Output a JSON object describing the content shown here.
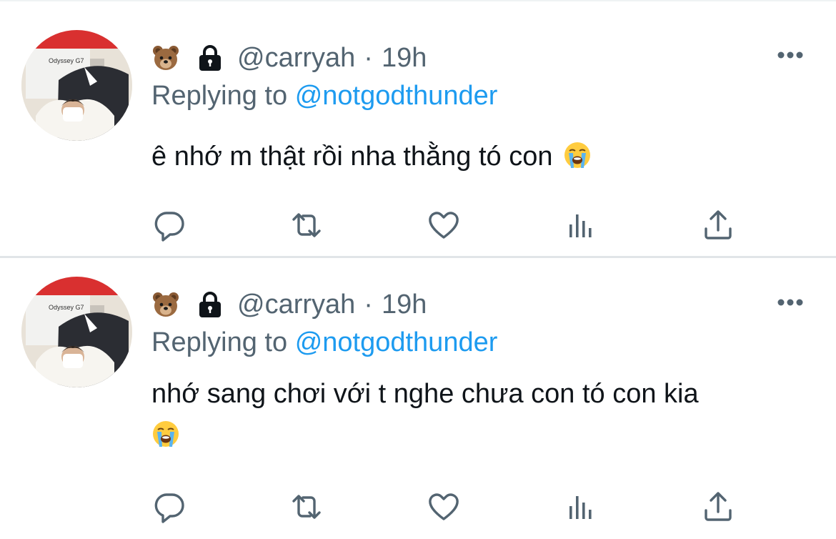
{
  "tweets": [
    {
      "handle": "@carryah",
      "separator": "·",
      "time": "19h",
      "reply_prefix": "Replying to",
      "reply_to": "@notgodthunder",
      "text": "ê nhớ m thật rồi nha thằng tó con",
      "emojis": [
        "bear-face",
        "loudly-crying-face"
      ],
      "avatar_text": "Odyssey G7"
    },
    {
      "handle": "@carryah",
      "separator": "·",
      "time": "19h",
      "reply_prefix": "Replying to",
      "reply_to": "@notgodthunder",
      "text": "nhớ sang chơi với t nghe chưa con tó con kia",
      "emojis": [
        "bear-face",
        "loudly-crying-face"
      ],
      "avatar_text": "Odyssey G7"
    }
  ],
  "icons": {
    "verified_lock": "lock-icon",
    "more": "more-horizontal-icon",
    "reply": "reply-icon",
    "retweet": "retweet-icon",
    "like": "heart-icon",
    "analytics": "analytics-icon",
    "share": "share-icon"
  },
  "colors": {
    "text_primary": "#0f1419",
    "text_secondary": "#536471",
    "link": "#1d9bf0",
    "divider": "#e1e5e8"
  }
}
